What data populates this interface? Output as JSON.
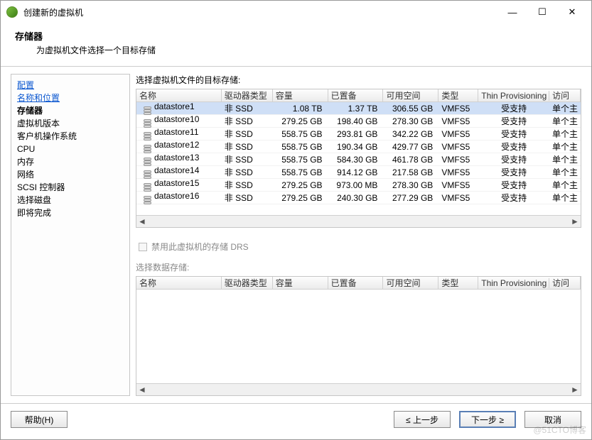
{
  "window": {
    "title": "创建新的虚拟机"
  },
  "header": {
    "title": "存储器",
    "subtitle": "为虚拟机文件选择一个目标存储"
  },
  "sidebar": {
    "steps": [
      {
        "label": "配置",
        "state": "link"
      },
      {
        "label": "名称和位置",
        "state": "link"
      },
      {
        "label": "存储器",
        "state": "current"
      },
      {
        "label": "虚拟机版本",
        "state": "future"
      },
      {
        "label": "客户机操作系统",
        "state": "future"
      },
      {
        "label": "CPU",
        "state": "future"
      },
      {
        "label": "内存",
        "state": "future"
      },
      {
        "label": "网络",
        "state": "future"
      },
      {
        "label": "SCSI 控制器",
        "state": "future"
      },
      {
        "label": "选择磁盘",
        "state": "future"
      },
      {
        "label": "即将完成",
        "state": "future"
      }
    ]
  },
  "upper": {
    "label": "选择虚拟机文件的目标存储:",
    "columns": [
      "名称",
      "驱动器类型",
      "容量",
      "已置备",
      "可用空间",
      "类型",
      "Thin Provisioning",
      "访问"
    ],
    "rows": [
      {
        "name": "datastore1",
        "drive": "非 SSD",
        "cap": "1.08 TB",
        "prov": "1.37 TB",
        "free": "306.55 GB",
        "fs": "VMFS5",
        "thin": "受支持",
        "acc": "单个主",
        "selected": true
      },
      {
        "name": "datastore10",
        "drive": "非 SSD",
        "cap": "279.25 GB",
        "prov": "198.40 GB",
        "free": "278.30 GB",
        "fs": "VMFS5",
        "thin": "受支持",
        "acc": "单个主"
      },
      {
        "name": "datastore11",
        "drive": "非 SSD",
        "cap": "558.75 GB",
        "prov": "293.81 GB",
        "free": "342.22 GB",
        "fs": "VMFS5",
        "thin": "受支持",
        "acc": "单个主"
      },
      {
        "name": "datastore12",
        "drive": "非 SSD",
        "cap": "558.75 GB",
        "prov": "190.34 GB",
        "free": "429.77 GB",
        "fs": "VMFS5",
        "thin": "受支持",
        "acc": "单个主"
      },
      {
        "name": "datastore13",
        "drive": "非 SSD",
        "cap": "558.75 GB",
        "prov": "584.30 GB",
        "free": "461.78 GB",
        "fs": "VMFS5",
        "thin": "受支持",
        "acc": "单个主"
      },
      {
        "name": "datastore14",
        "drive": "非 SSD",
        "cap": "558.75 GB",
        "prov": "914.12 GB",
        "free": "217.58 GB",
        "fs": "VMFS5",
        "thin": "受支持",
        "acc": "单个主"
      },
      {
        "name": "datastore15",
        "drive": "非 SSD",
        "cap": "279.25 GB",
        "prov": "973.00 MB",
        "free": "278.30 GB",
        "fs": "VMFS5",
        "thin": "受支持",
        "acc": "单个主"
      },
      {
        "name": "datastore16",
        "drive": "非 SSD",
        "cap": "279.25 GB",
        "prov": "240.30 GB",
        "free": "277.29 GB",
        "fs": "VMFS5",
        "thin": "受支持",
        "acc": "单个主"
      }
    ]
  },
  "drs": {
    "label": "禁用此虚拟机的存储 DRS",
    "checked": false,
    "disabled": true
  },
  "lower": {
    "label": "选择数据存储:",
    "columns": [
      "名称",
      "驱动器类型",
      "容量",
      "已置备",
      "可用空间",
      "类型",
      "Thin Provisioning",
      "访问"
    ]
  },
  "footer": {
    "help": "帮助(H)",
    "back": "≤ 上一步",
    "next": "下一步 ≥",
    "cancel": "取消"
  },
  "watermark": "@51CTO博客"
}
